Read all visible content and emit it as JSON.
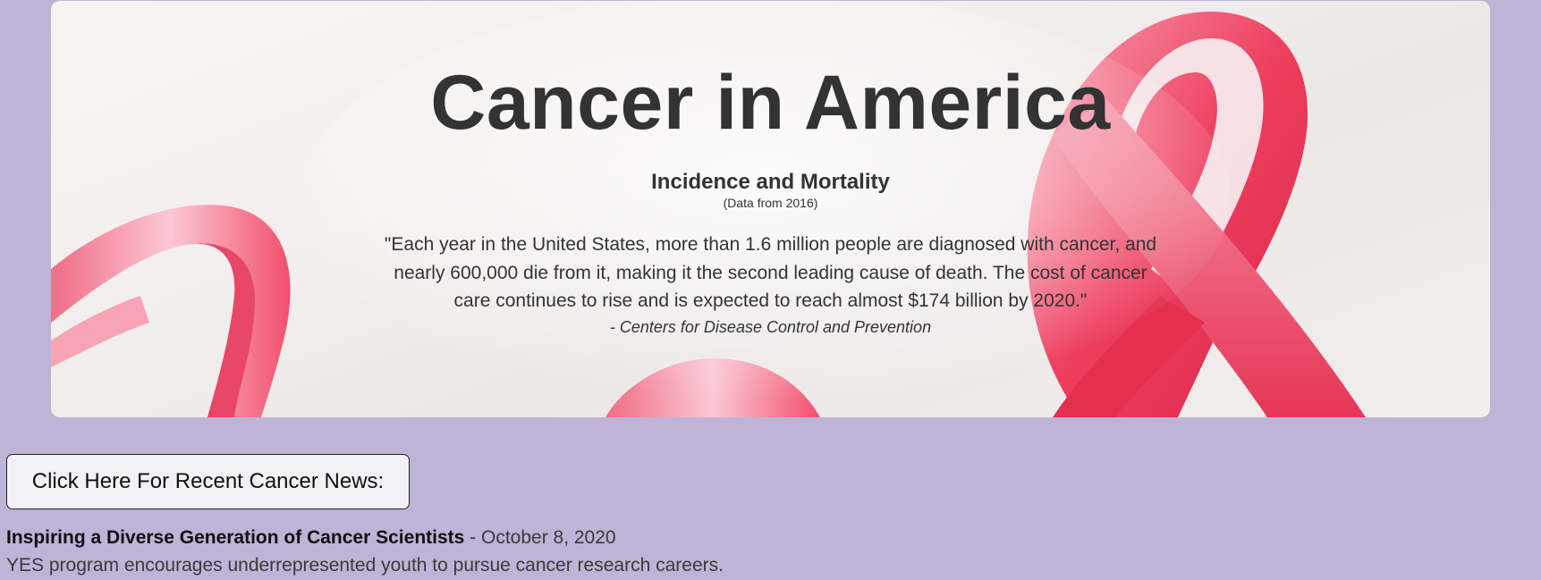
{
  "hero": {
    "title": "Cancer in America",
    "subtitle": "Incidence and Mortality",
    "date_note": "(Data from 2016)",
    "quote": "\"Each year in the United States, more than 1.6 million people are diagnosed with cancer, and nearly 600,000 die from it, making it the second leading cause of death. The cost of cancer care continues to rise and is expected to reach almost $174 billion by 2020.\"",
    "attribution": "- Centers for Disease Control and Prevention",
    "image_icon": "pink-ribbon-icon"
  },
  "news": {
    "button_label": "Click Here For Recent Cancer News:",
    "items": [
      {
        "headline": "Inspiring a Diverse Generation of Cancer Scientists",
        "separator": " - ",
        "date": "October 8, 2020",
        "summary": "YES program encourages underrepresented youth to pursue cancer research careers."
      }
    ]
  },
  "colors": {
    "page_background": "#bfb3d8",
    "ribbon": "#ef3e5e",
    "text": "#333333"
  }
}
